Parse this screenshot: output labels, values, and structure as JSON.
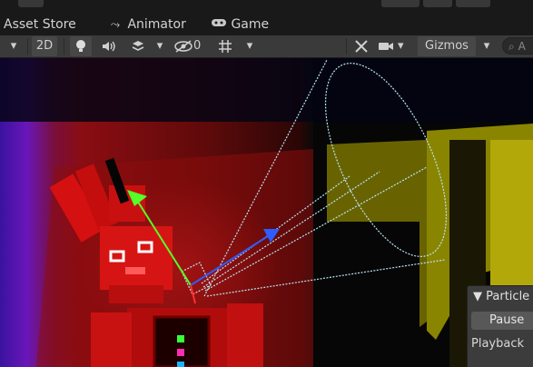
{
  "tabs": {
    "asset_store": {
      "label": "Asset Store"
    },
    "animator": {
      "label": "Animator",
      "icon": "animator-icon"
    },
    "game": {
      "label": "Game",
      "icon": "gamepad-icon"
    }
  },
  "toolbar": {
    "mode_2d": "2D",
    "hidden_count": "0",
    "gizmos_label": "Gizmos",
    "search_placeholder": "A"
  },
  "particle_panel": {
    "title": "Particle",
    "pause_label": "Pause",
    "playback_label": "Playback",
    "second_row_label": "Playback"
  },
  "colors": {
    "accent_red": "#ff1e1e",
    "gizmo_blue_arrow": "#2f5cff",
    "gizmo_green_arrow": "#55ff2a",
    "cone_line": "#b9e6f2"
  }
}
